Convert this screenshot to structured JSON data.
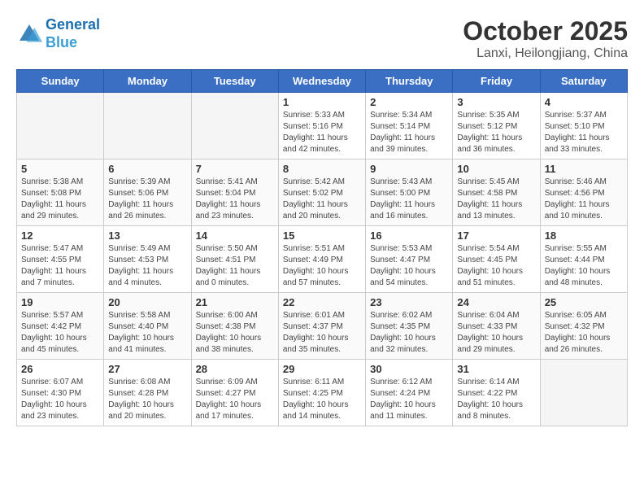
{
  "header": {
    "logo_line1": "General",
    "logo_line2": "Blue",
    "month": "October 2025",
    "location": "Lanxi, Heilongjiang, China"
  },
  "weekdays": [
    "Sunday",
    "Monday",
    "Tuesday",
    "Wednesday",
    "Thursday",
    "Friday",
    "Saturday"
  ],
  "weeks": [
    [
      {
        "day": "",
        "info": ""
      },
      {
        "day": "",
        "info": ""
      },
      {
        "day": "",
        "info": ""
      },
      {
        "day": "1",
        "info": "Sunrise: 5:33 AM\nSunset: 5:16 PM\nDaylight: 11 hours\nand 42 minutes."
      },
      {
        "day": "2",
        "info": "Sunrise: 5:34 AM\nSunset: 5:14 PM\nDaylight: 11 hours\nand 39 minutes."
      },
      {
        "day": "3",
        "info": "Sunrise: 5:35 AM\nSunset: 5:12 PM\nDaylight: 11 hours\nand 36 minutes."
      },
      {
        "day": "4",
        "info": "Sunrise: 5:37 AM\nSunset: 5:10 PM\nDaylight: 11 hours\nand 33 minutes."
      }
    ],
    [
      {
        "day": "5",
        "info": "Sunrise: 5:38 AM\nSunset: 5:08 PM\nDaylight: 11 hours\nand 29 minutes."
      },
      {
        "day": "6",
        "info": "Sunrise: 5:39 AM\nSunset: 5:06 PM\nDaylight: 11 hours\nand 26 minutes."
      },
      {
        "day": "7",
        "info": "Sunrise: 5:41 AM\nSunset: 5:04 PM\nDaylight: 11 hours\nand 23 minutes."
      },
      {
        "day": "8",
        "info": "Sunrise: 5:42 AM\nSunset: 5:02 PM\nDaylight: 11 hours\nand 20 minutes."
      },
      {
        "day": "9",
        "info": "Sunrise: 5:43 AM\nSunset: 5:00 PM\nDaylight: 11 hours\nand 16 minutes."
      },
      {
        "day": "10",
        "info": "Sunrise: 5:45 AM\nSunset: 4:58 PM\nDaylight: 11 hours\nand 13 minutes."
      },
      {
        "day": "11",
        "info": "Sunrise: 5:46 AM\nSunset: 4:56 PM\nDaylight: 11 hours\nand 10 minutes."
      }
    ],
    [
      {
        "day": "12",
        "info": "Sunrise: 5:47 AM\nSunset: 4:55 PM\nDaylight: 11 hours\nand 7 minutes."
      },
      {
        "day": "13",
        "info": "Sunrise: 5:49 AM\nSunset: 4:53 PM\nDaylight: 11 hours\nand 4 minutes."
      },
      {
        "day": "14",
        "info": "Sunrise: 5:50 AM\nSunset: 4:51 PM\nDaylight: 11 hours\nand 0 minutes."
      },
      {
        "day": "15",
        "info": "Sunrise: 5:51 AM\nSunset: 4:49 PM\nDaylight: 10 hours\nand 57 minutes."
      },
      {
        "day": "16",
        "info": "Sunrise: 5:53 AM\nSunset: 4:47 PM\nDaylight: 10 hours\nand 54 minutes."
      },
      {
        "day": "17",
        "info": "Sunrise: 5:54 AM\nSunset: 4:45 PM\nDaylight: 10 hours\nand 51 minutes."
      },
      {
        "day": "18",
        "info": "Sunrise: 5:55 AM\nSunset: 4:44 PM\nDaylight: 10 hours\nand 48 minutes."
      }
    ],
    [
      {
        "day": "19",
        "info": "Sunrise: 5:57 AM\nSunset: 4:42 PM\nDaylight: 10 hours\nand 45 minutes."
      },
      {
        "day": "20",
        "info": "Sunrise: 5:58 AM\nSunset: 4:40 PM\nDaylight: 10 hours\nand 41 minutes."
      },
      {
        "day": "21",
        "info": "Sunrise: 6:00 AM\nSunset: 4:38 PM\nDaylight: 10 hours\nand 38 minutes."
      },
      {
        "day": "22",
        "info": "Sunrise: 6:01 AM\nSunset: 4:37 PM\nDaylight: 10 hours\nand 35 minutes."
      },
      {
        "day": "23",
        "info": "Sunrise: 6:02 AM\nSunset: 4:35 PM\nDaylight: 10 hours\nand 32 minutes."
      },
      {
        "day": "24",
        "info": "Sunrise: 6:04 AM\nSunset: 4:33 PM\nDaylight: 10 hours\nand 29 minutes."
      },
      {
        "day": "25",
        "info": "Sunrise: 6:05 AM\nSunset: 4:32 PM\nDaylight: 10 hours\nand 26 minutes."
      }
    ],
    [
      {
        "day": "26",
        "info": "Sunrise: 6:07 AM\nSunset: 4:30 PM\nDaylight: 10 hours\nand 23 minutes."
      },
      {
        "day": "27",
        "info": "Sunrise: 6:08 AM\nSunset: 4:28 PM\nDaylight: 10 hours\nand 20 minutes."
      },
      {
        "day": "28",
        "info": "Sunrise: 6:09 AM\nSunset: 4:27 PM\nDaylight: 10 hours\nand 17 minutes."
      },
      {
        "day": "29",
        "info": "Sunrise: 6:11 AM\nSunset: 4:25 PM\nDaylight: 10 hours\nand 14 minutes."
      },
      {
        "day": "30",
        "info": "Sunrise: 6:12 AM\nSunset: 4:24 PM\nDaylight: 10 hours\nand 11 minutes."
      },
      {
        "day": "31",
        "info": "Sunrise: 6:14 AM\nSunset: 4:22 PM\nDaylight: 10 hours\nand 8 minutes."
      },
      {
        "day": "",
        "info": ""
      }
    ]
  ]
}
